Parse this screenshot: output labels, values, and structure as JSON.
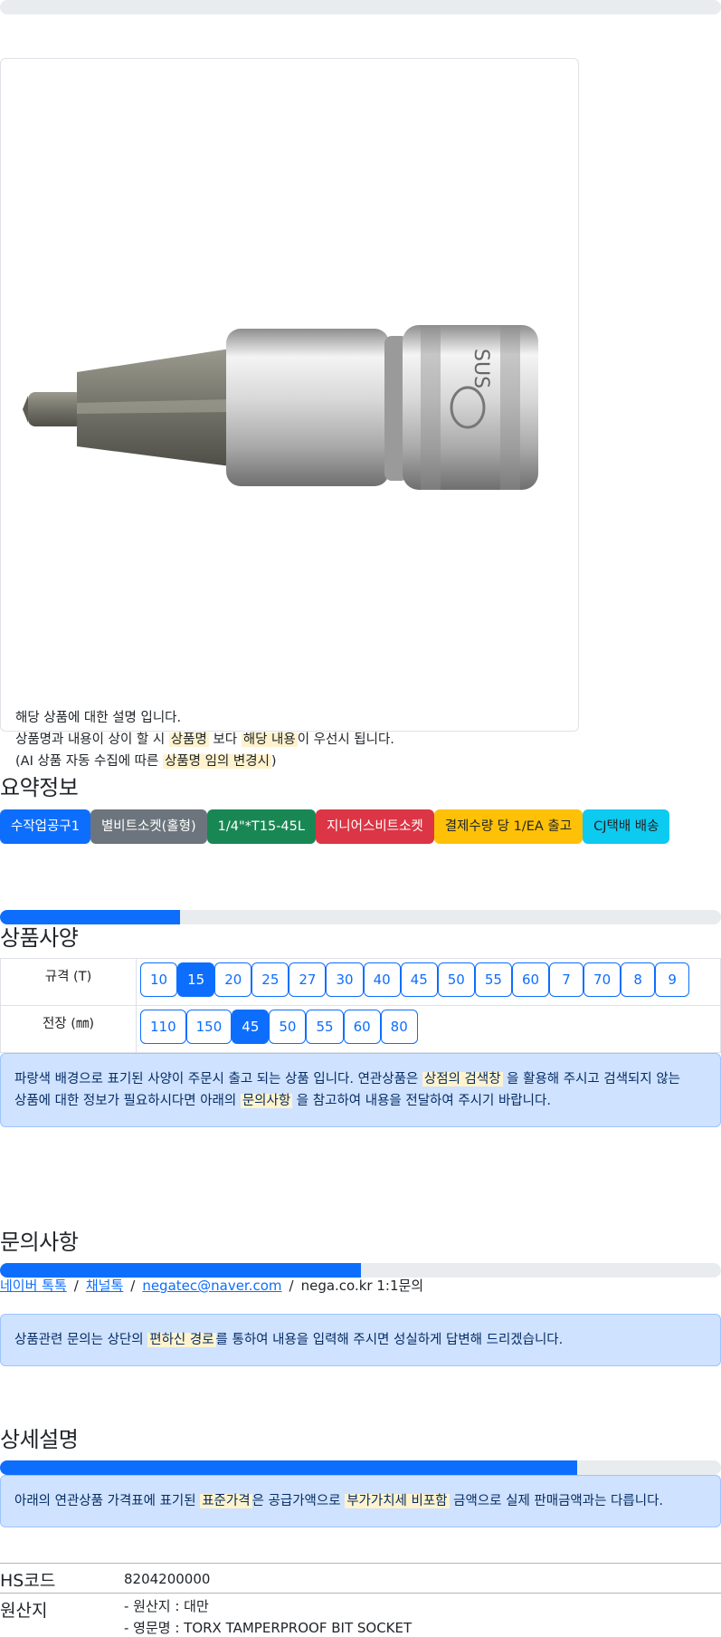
{
  "image_card": {
    "note_line1": "해당 상품에 대한 설명 입니다.",
    "note_line2_a": "상품명과 내용이 상이 할 시 ",
    "note_line2_hl1": "상품명",
    "note_line2_b": " 보다 ",
    "note_line2_hl2": "해당 내용",
    "note_line2_c": "이 우선시 됩니다.",
    "note_line3_a": "(AI 상품 자동 수집에 따른 ",
    "note_line3_hl": "상품명 임의 변경시",
    "note_line3_b": ")",
    "product_engraving": "SUS"
  },
  "summary": {
    "title": "요약정보",
    "tags": [
      {
        "label": "수작업공구1",
        "color": "#0d6efd"
      },
      {
        "label": "별비트소켓(홀형)",
        "color": "#6c757d"
      },
      {
        "label": "1/4\"*T15-45L",
        "color": "#198754"
      },
      {
        "label": "지니어스비트소켓",
        "color": "#dc3545"
      },
      {
        "label": "결제수량 당 1/EA 출고",
        "color": "#ffc107"
      },
      {
        "label": "CJ택배 배송",
        "color": "#0dcaf0"
      }
    ]
  },
  "spec": {
    "progress_percent": 25,
    "title": "상품사양",
    "rows": [
      {
        "label": "규격 (T)",
        "options": [
          "10",
          "15",
          "20",
          "25",
          "27",
          "30",
          "40",
          "45",
          "50",
          "55",
          "60",
          "7",
          "70",
          "8",
          "9"
        ],
        "selected": "15"
      },
      {
        "label": "전장 (㎜)",
        "options": [
          "110",
          "150",
          "45",
          "50",
          "55",
          "60",
          "80"
        ],
        "selected": "45"
      }
    ],
    "alert_a": "파랑색 배경으로 표기된 사양이 주문시 출고 되는 상품 입니다. 연관상품은 ",
    "alert_hl1": "상점의 검색창",
    "alert_b": " 을 활용해 주시고 검색되지 않는",
    "alert_c": "상품에 대한 정보가 필요하시다면 아래의 ",
    "alert_hl2": "문의사항",
    "alert_d": " 을 참고하여 내용을 전달하여 주시기 바랍니다."
  },
  "inquiry": {
    "title": "문의사항",
    "progress_percent": 50,
    "links": [
      "네이버 톡톡",
      "채널톡",
      "negatec@naver.com"
    ],
    "plain_link": "nega.co.kr 1:1문의",
    "alert_a": "상품관련 문의는 상단의 ",
    "alert_hl": "편하신 경로",
    "alert_b": "를 통하여 내용을 입력해 주시면 성실하게 답변해 드리겠습니다."
  },
  "detail": {
    "title": "상세설명",
    "progress_percent": 80,
    "alert_a": "아래의 연관상품 가격표에 표기된 ",
    "alert_hl1": "표준가격",
    "alert_b": "은 공급가액으로 ",
    "alert_hl2": "부가가치세 비포함",
    "alert_c": " 금액으로 실제 판매금액과는 다릅니다."
  },
  "info": {
    "hs_key": "HS코드",
    "hs_value": "8204200000",
    "origin_key": "원산지",
    "origin_line1": "- 원산지 : 대만",
    "origin_line2": "- 영문명 : TORX TAMPERPROOF BIT SOCKET"
  }
}
